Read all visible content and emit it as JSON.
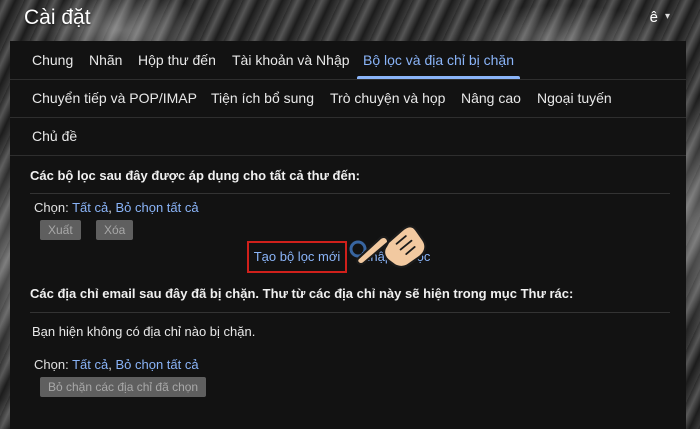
{
  "header": {
    "title": "Cài đặt",
    "user_initial": "ê"
  },
  "tabs_row1": [
    {
      "label": "Chung",
      "active": false
    },
    {
      "label": "Nhãn",
      "active": false
    },
    {
      "label": "Hộp thư đến",
      "active": false
    },
    {
      "label": "Tài khoản và Nhập",
      "active": false
    },
    {
      "label": "Bộ lọc và địa chỉ bị chặn",
      "active": true
    }
  ],
  "tabs_row2": [
    {
      "label": "Chuyển tiếp và POP/IMAP"
    },
    {
      "label": "Tiện ích bổ sung"
    },
    {
      "label": "Trò chuyện và họp"
    },
    {
      "label": "Nâng cao"
    },
    {
      "label": "Ngoại tuyến"
    }
  ],
  "tabs_row3": [
    {
      "label": "Chủ đề"
    }
  ],
  "filters": {
    "title": "Các bộ lọc sau đây được áp dụng cho tất cả thư đến:",
    "select_label": "Chọn:",
    "select_all": "Tất cả",
    "separator": ",",
    "deselect_all": "Bỏ chọn tất cả",
    "export_button": "Xuất",
    "delete_button": "Xóa",
    "create_filter": "Tạo bộ lọc mới",
    "import_filter": "Nhập bộ lọc"
  },
  "blocked": {
    "title": "Các địa chỉ email sau đây đã bị chặn. Thư từ các địa chỉ này sẽ hiện trong mục Thư rác:",
    "empty_text": "Bạn hiện không có địa chỉ nào bị chặn.",
    "select_label": "Chọn:",
    "select_all": "Tất cả",
    "separator": ",",
    "deselect_all": "Bỏ chọn tất cả",
    "unblock_button": "Bỏ chặn các địa chỉ đã chọn"
  },
  "colors": {
    "accent": "#8ab4f8",
    "highlight_box": "#d0201b",
    "panel_bg": "#121212"
  },
  "icons": {
    "pointer": "pointing-hand-icon",
    "caret": "chevron-down-icon"
  }
}
